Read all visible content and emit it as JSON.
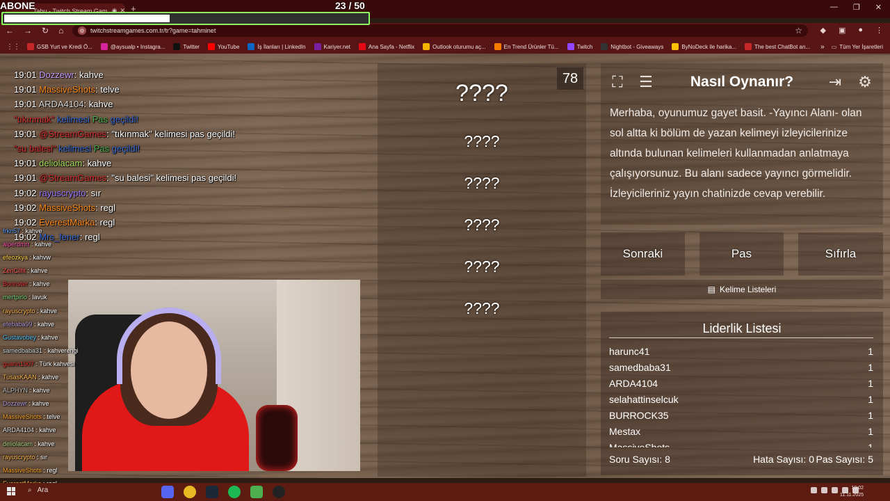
{
  "browser": {
    "tab_title": "Tabu - Twitch Stream Gam...",
    "new_tab": "+",
    "url": "twitchstreamgames.com.tr/tr?game=tahminet",
    "window_controls": [
      "—",
      "❐",
      "✕"
    ]
  },
  "overlay": {
    "subscribe_label": "ABONE",
    "progress_text": "23  / 50",
    "progress_value": 0.46,
    "progress_color": "#8dff5c"
  },
  "bookmarks": {
    "items": [
      {
        "label": "GSB Yurt ve Kredi Ö...",
        "color": "#c62828"
      },
      {
        "label": "@aysualp • Instagra...",
        "color": "#d6249f"
      },
      {
        "label": "Twitter",
        "color": "#111111"
      },
      {
        "label": "YouTube",
        "color": "#ff0000"
      },
      {
        "label": "İş İlanları | LinkedIn",
        "color": "#0a66c2"
      },
      {
        "label": "Kariyer.net",
        "color": "#7b1fa2"
      },
      {
        "label": "Ana Sayfa - Netflix",
        "color": "#e50914"
      },
      {
        "label": "Outlook oturumu aç...",
        "color": "#f4b400"
      },
      {
        "label": "En Trend Ürünler Tü...",
        "color": "#f57c00"
      },
      {
        "label": "Twitch",
        "color": "#9146ff"
      },
      {
        "label": "Nightbot - Giveaways",
        "color": "#333333"
      },
      {
        "label": "ByNoDeck ile harika...",
        "color": "#ffc107"
      },
      {
        "label": "The best ChatBot an...",
        "color": "#c62828"
      }
    ],
    "more": "»",
    "all_label": "Tüm Yer İşaretleri"
  },
  "chat_log": [
    {
      "time": "19:01",
      "user": "Dozzewr",
      "color": "#c9a0ff",
      "msg": "kahve"
    },
    {
      "time": "19:01",
      "user": "MassiveShots",
      "color": "#ff8c1a",
      "msg": "telve"
    },
    {
      "time": "19:01",
      "user": "ARDA4104",
      "color": "#d8d8d8",
      "msg": "kahve"
    },
    {
      "system": true,
      "a": "\"tıkınmak\"",
      "b": "kelimesi",
      "c": "Pas",
      "d": "geçildi!"
    },
    {
      "time": "19:01",
      "user": "@StreamGames",
      "color": "#d63030",
      "msg": "\"tıkınmak\" kelimesi pas geçildi!"
    },
    {
      "system": true,
      "a": "\"su balesi\"",
      "b": "kelimesi",
      "c": "Pas",
      "d": "geçildi!"
    },
    {
      "time": "19:01",
      "user": "deliolacam",
      "color": "#a8e060",
      "msg": "kahve"
    },
    {
      "time": "19:01",
      "user": "@StreamGames",
      "color": "#d63030",
      "msg": "\"su balesi\" kelimesi pas geçildi!"
    },
    {
      "time": "19:02",
      "user": "rayuscrypto",
      "color": "#9a7cff",
      "msg": "sır"
    },
    {
      "time": "19:02",
      "user": "MassiveShots",
      "color": "#ff8c1a",
      "msg": "regl"
    },
    {
      "time": "19:02",
      "user": "EverestMarka",
      "color": "#ff8c1a",
      "msg": "regl"
    },
    {
      "time": "19:02",
      "user": "Mrs_fener",
      "color": "#3b6cd4",
      "msg": "regl"
    }
  ],
  "stream_chat": [
    {
      "user": "frkn57",
      "color": "#5aa0ff",
      "msg": ": kahve"
    },
    {
      "user": "alperdmrr",
      "color": "#ff5ab0",
      "msg": ": kahve"
    },
    {
      "user": "efeozkya",
      "color": "#ffd54a",
      "msg": ": kahvw"
    },
    {
      "user": "ZenCilfit",
      "color": "#ff5a5a",
      "msg": ": kahve"
    },
    {
      "user": "Bonnster",
      "color": "#e53935",
      "msg": ": kahve"
    },
    {
      "user": "mertpirlo",
      "color": "#7bd97b",
      "msg": ": lavuk"
    },
    {
      "user": "rayuscrypto",
      "color": "#ffb74d",
      "msg": ": kahve"
    },
    {
      "user": "efebaba99",
      "color": "#b39ddb",
      "msg": ": kahve"
    },
    {
      "user": "Gustavobey",
      "color": "#4fc3f7",
      "msg": ": kahve"
    },
    {
      "user": "samedbaba31",
      "color": "#cfd8dc",
      "msg": ": kahverengi"
    },
    {
      "user": "guarin1907",
      "color": "#e53935",
      "msg": ": Türk kahvesi"
    },
    {
      "user": "TusasKAAN",
      "color": "#ffb74d",
      "msg": ": kahve"
    },
    {
      "user": "ALPHYN",
      "color": "#bdbdbd",
      "msg": ": kahve"
    },
    {
      "user": "Dozzewr",
      "color": "#b39ddb",
      "msg": ": kahve"
    },
    {
      "user": "MassiveShots",
      "color": "#ffa726",
      "msg": ": telve"
    },
    {
      "user": "ARDA4104",
      "color": "#e0e0e0",
      "msg": ": kahve"
    },
    {
      "user": "deliolacam",
      "color": "#aed581",
      "msg": ": kahve"
    },
    {
      "user": "rayuscrypto",
      "color": "#ffb74d",
      "msg": ": sır"
    },
    {
      "user": "MassiveShots",
      "color": "#ffa726",
      "msg": ": regl"
    },
    {
      "user": "EverestMarka",
      "color": "#ffb74d",
      "msg": ": regl"
    }
  ],
  "game": {
    "timer": "78",
    "words": [
      "????",
      "????",
      "????",
      "????",
      "????",
      "????"
    ]
  },
  "info": {
    "title": "Nasıl Oynanır?",
    "text": "Merhaba, oyunumuz gayet basit. -Yayıncı Alanı- olan sol altta ki bölüm de yazan kelimeyi izleyicilerinize altında bulunan kelimeleri kullanmadan anlatmaya çalışıyorsunuz. Bu alanı sadece yayıncı görmelidir. İzleyicileriniz yayın chatinizde cevap verebilir."
  },
  "controls": {
    "next": "Sonraki",
    "pass": "Pas",
    "reset": "Sıfırla",
    "word_lists": "Kelime Listeleri"
  },
  "leaderboard": {
    "title": "Liderlik Listesi",
    "rows": [
      {
        "name": "harunc41",
        "score": "1"
      },
      {
        "name": "samedbaba31",
        "score": "1"
      },
      {
        "name": "ARDA4104",
        "score": "1"
      },
      {
        "name": "selahattinselcuk",
        "score": "1"
      },
      {
        "name": "BURROCK35",
        "score": "1"
      },
      {
        "name": "Mestax",
        "score": "1"
      },
      {
        "name": "MassiveShots",
        "score": "1"
      }
    ],
    "stats": {
      "questions": "Soru Sayısı: 8",
      "errors": "Hata Sayısı: 0",
      "passes": "Pas Sayısı: 5"
    }
  },
  "taskbar": {
    "search": "Ara",
    "clock_time": "19:02",
    "clock_date": "11.11.2025"
  }
}
